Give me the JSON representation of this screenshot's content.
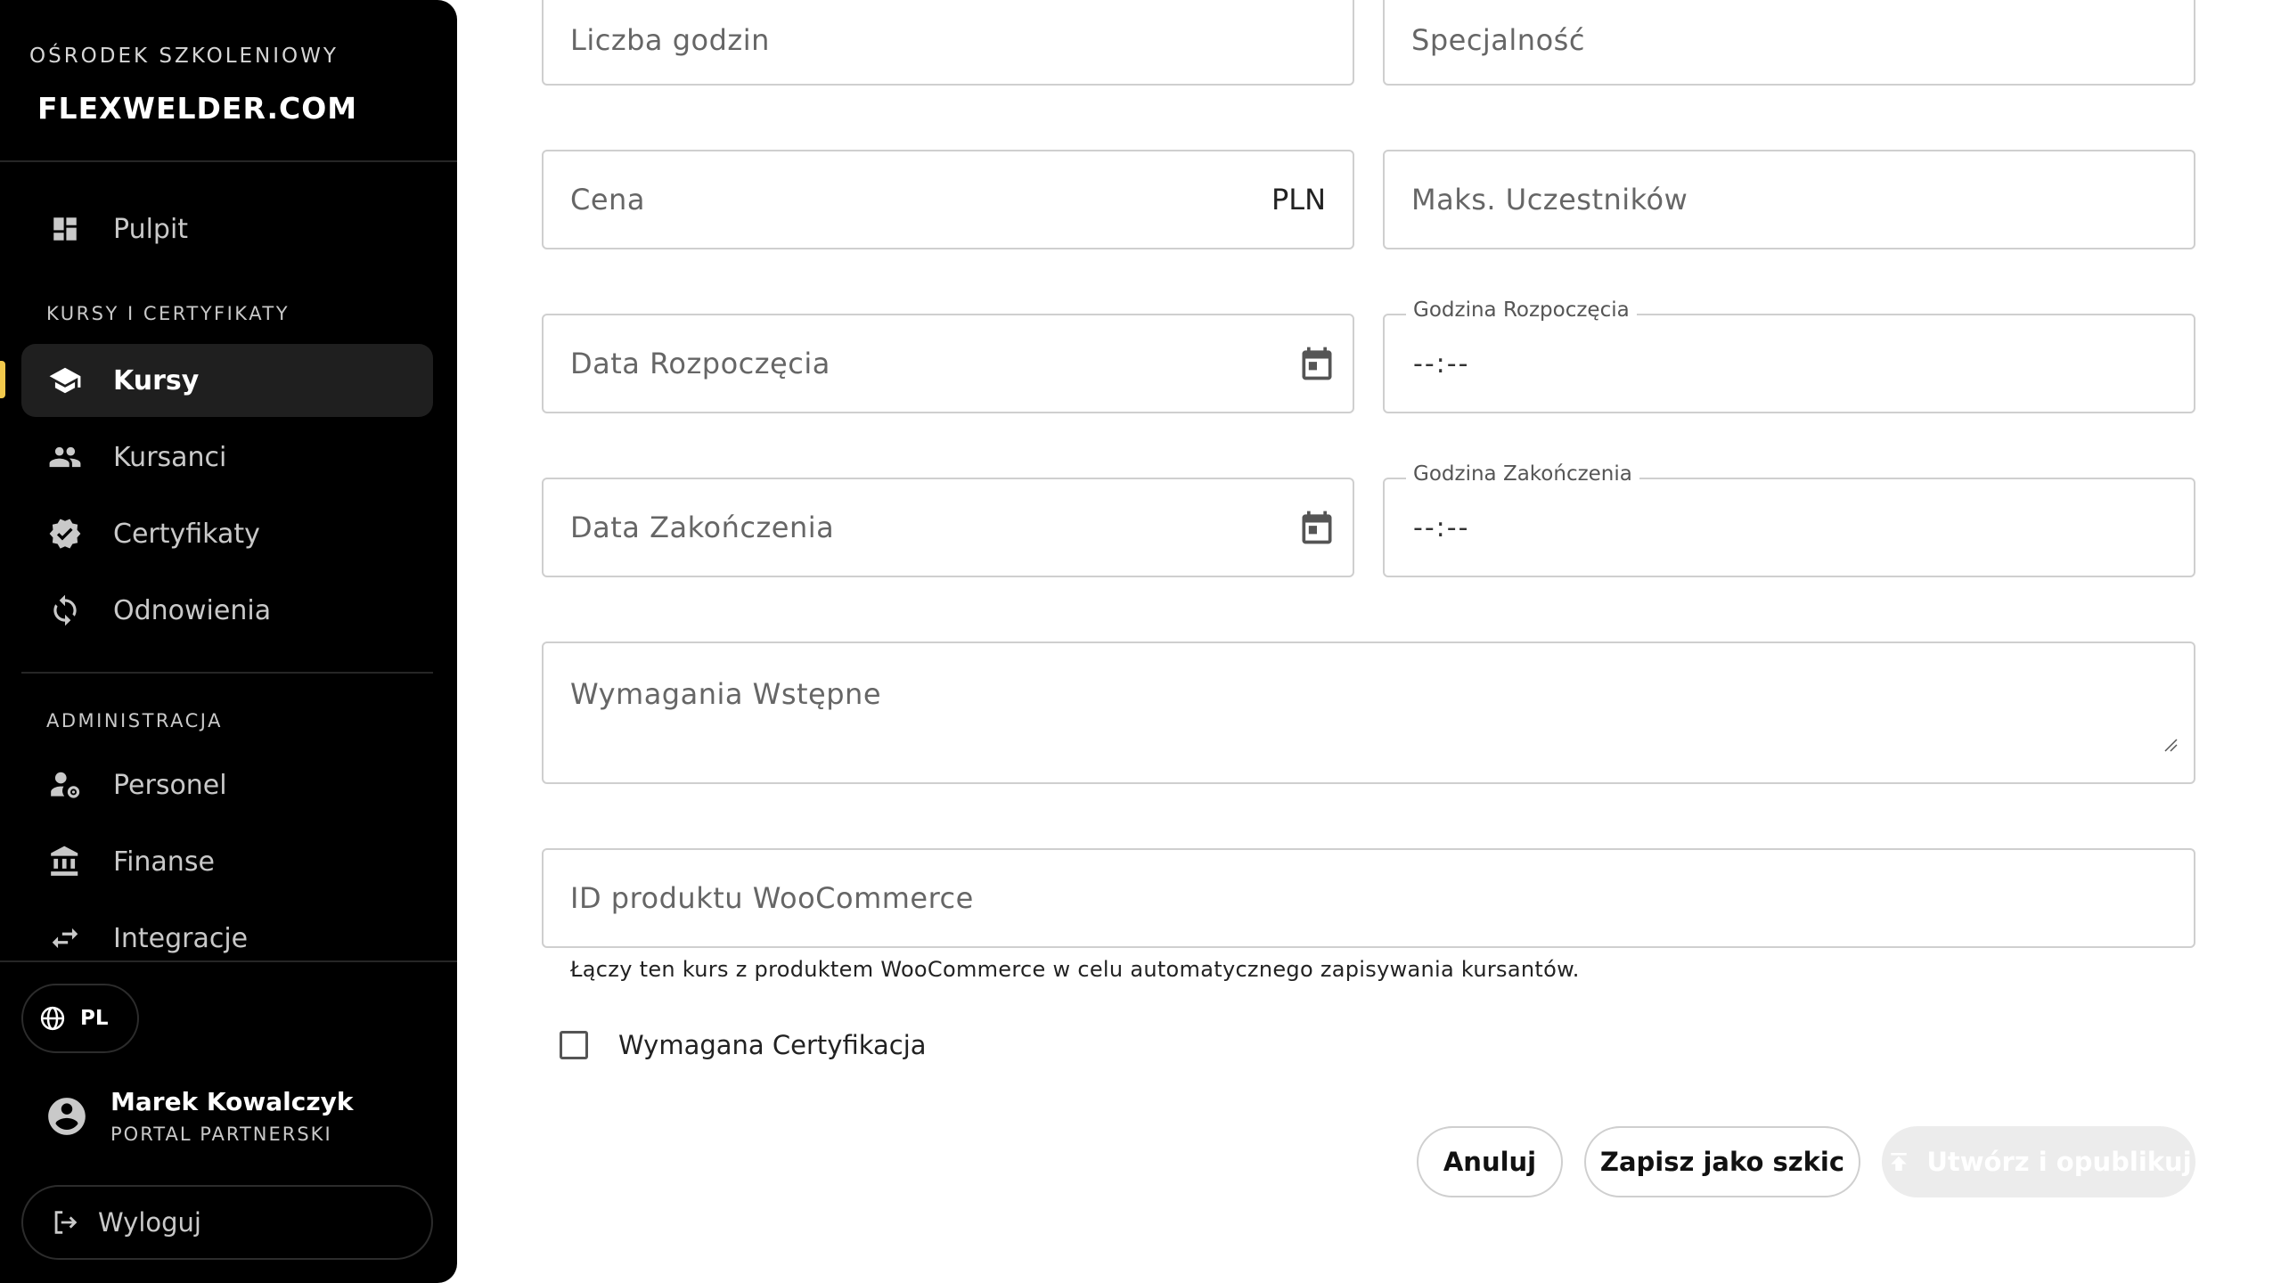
{
  "sidebar": {
    "brand_tag": "OŚRODEK SZKOLENIOWY",
    "brand_name": "FLEXWELDER.COM",
    "dashboard_label": "Pulpit",
    "section_courses": "KURSY I CERTYFIKATY",
    "courses_label": "Kursy",
    "students_label": "Kursanci",
    "certificates_label": "Certyfikaty",
    "renewals_label": "Odnowienia",
    "section_admin": "ADMINISTRACJA",
    "staff_label": "Personel",
    "finance_label": "Finanse",
    "integrations_label": "Integracje",
    "language": "PL",
    "user_name": "Marek Kowalczyk",
    "user_role": "PORTAL PARTNERSKI",
    "logout_label": "Wyloguj",
    "accent_color": "#f2c94c"
  },
  "form": {
    "hours_placeholder": "Liczba godzin",
    "specialty_placeholder": "Specjalność",
    "price_placeholder": "Cena",
    "price_currency": "PLN",
    "max_participants_placeholder": "Maks. Uczestników",
    "start_date_placeholder": "Data Rozpoczęcia",
    "start_time_label": "Godzina Rozpoczęcia",
    "start_time_value": "--:--",
    "end_date_placeholder": "Data Zakończenia",
    "end_time_label": "Godzina Zakończenia",
    "end_time_value": "--:--",
    "prerequisites_placeholder": "Wymagania Wstępne",
    "woo_id_placeholder": "ID produktu WooCommerce",
    "woo_helper": "Łączy ten kurs z produktem WooCommerce w celu automatycznego zapisywania kursantów.",
    "certification_required_label": "Wymagana Certyfikacja",
    "certification_required_checked": false
  },
  "actions": {
    "cancel_label": "Anuluj",
    "save_draft_label": "Zapisz jako szkic",
    "publish_label": "Utwórz i opublikuj"
  },
  "icons": {
    "dashboard": "dashboard-icon",
    "courses": "graduation-cap-icon",
    "students": "people-icon",
    "certificates": "verified-badge-icon",
    "renewals": "refresh-icon",
    "staff": "user-gear-icon",
    "finance": "bank-icon",
    "integrations": "swap-arrows-icon",
    "language": "globe-icon",
    "user": "account-circle-icon",
    "logout": "logout-icon",
    "calendar": "calendar-icon",
    "publish": "upload-icon"
  }
}
